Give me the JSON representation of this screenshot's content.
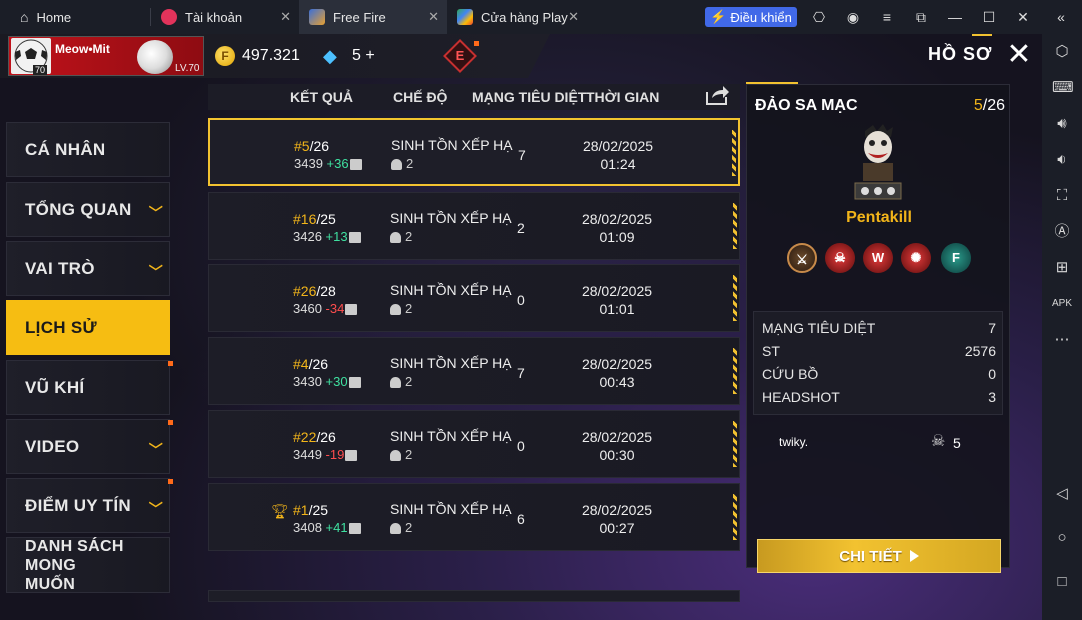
{
  "emulator": {
    "tabs": [
      {
        "label": "Home"
      },
      {
        "label": "Tài khoản"
      },
      {
        "label": "Free Fire"
      },
      {
        "label": "Cửa hàng Play"
      }
    ],
    "control_button": "Điều khiển",
    "icons": [
      "gamepad-icon",
      "account-icon",
      "menu-icon",
      "restore-icon",
      "minimize-icon",
      "maximize-icon",
      "close-icon",
      "collapse-icon"
    ]
  },
  "header": {
    "player_name": "Meow•Mit",
    "avatar_level": "70",
    "player_level": "LV.70",
    "coins": "497.321",
    "diamonds": "5",
    "diamond_plus": "+",
    "e_badge": "E",
    "page_title": "HỒ SƠ",
    "close": "✕"
  },
  "menu": [
    {
      "label": "CÁ NHÂN",
      "chevron": false
    },
    {
      "label": "TỔNG QUAN",
      "chevron": true
    },
    {
      "label": "VAI TRÒ",
      "chevron": true
    },
    {
      "label": "LỊCH SỬ",
      "chevron": false,
      "active": true
    },
    {
      "label": "VŨ KHÍ",
      "chevron": false
    },
    {
      "label": "VIDEO",
      "chevron": true
    },
    {
      "label": "ĐIỂM UY TÍN",
      "chevron": true
    },
    {
      "label": "DANH SÁCH MONG MUỐN",
      "chevron": false
    }
  ],
  "table": {
    "headers": {
      "result": "KẾT QUẢ",
      "mode": "CHẾ ĐỘ",
      "kills": "MẠNG TIÊU DIỆT",
      "time": "THỜI GIAN"
    },
    "rows": [
      {
        "rank": "#5",
        "of": "/26",
        "points": "3439",
        "delta": "+36",
        "mode": "SINH TỒN XẾP HẠ",
        "players": "2",
        "kills": "7",
        "date": "28/02/2025",
        "time": "01:24"
      },
      {
        "rank": "#16",
        "of": "/25",
        "points": "3426",
        "delta": "+13",
        "mode": "SINH TỒN XẾP HẠ",
        "players": "2",
        "kills": "2",
        "date": "28/02/2025",
        "time": "01:09"
      },
      {
        "rank": "#26",
        "of": "/28",
        "points": "3460",
        "delta": "-34",
        "mode": "SINH TỒN XẾP HẠ",
        "players": "2",
        "kills": "0",
        "date": "28/02/2025",
        "time": "01:01"
      },
      {
        "rank": "#4",
        "of": "/26",
        "points": "3430",
        "delta": "+30",
        "mode": "SINH TỒN XẾP HẠ",
        "players": "2",
        "kills": "7",
        "date": "28/02/2025",
        "time": "00:43"
      },
      {
        "rank": "#22",
        "of": "/26",
        "points": "3449",
        "delta": "-19",
        "mode": "SINH TỒN XẾP HẠ",
        "players": "2",
        "kills": "0",
        "date": "28/02/2025",
        "time": "00:30"
      },
      {
        "rank": "#1",
        "of": "/25",
        "points": "3408",
        "delta": "+41",
        "mode": "SINH TỒN XẾP HẠ",
        "players": "2",
        "kills": "6",
        "date": "28/02/2025",
        "time": "00:27"
      }
    ]
  },
  "detail": {
    "map": "ĐẢO SA MẠC",
    "rank": "5",
    "rank_of": "/26",
    "title": "Pentakill",
    "stats": [
      {
        "label": "MẠNG TIÊU DIỆT",
        "value": "7"
      },
      {
        "label": "ST",
        "value": "2576"
      },
      {
        "label": "CỨU BỒ",
        "value": "0"
      },
      {
        "label": "HEADSHOT",
        "value": "3"
      }
    ],
    "teammate": "twiky.",
    "teammate_kills": "5",
    "button": "CHI TIẾT"
  },
  "colors": {
    "accent": "#f6bd12",
    "positive": "#3fe0a0",
    "negative": "#ff4d4d",
    "control_blue": "#4169e8"
  }
}
